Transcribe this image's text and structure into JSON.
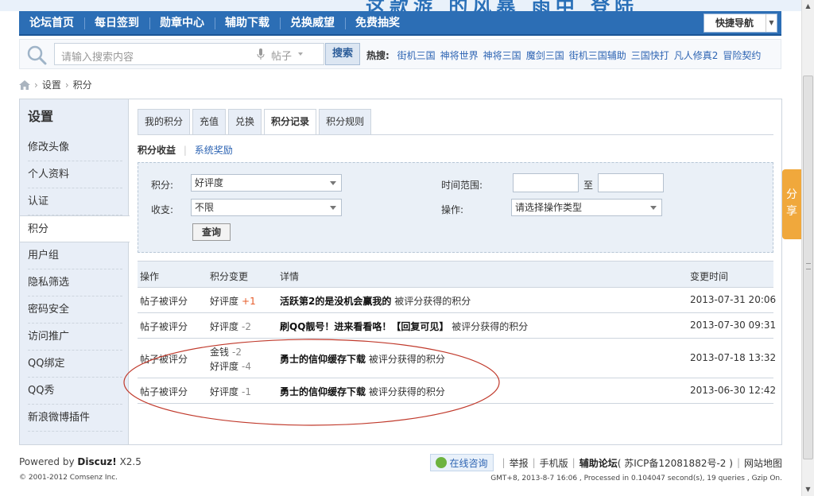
{
  "nav": {
    "items": [
      "论坛首页",
      "每日签到",
      "勋章中心",
      "辅助下载",
      "兑换威望",
      "免费抽奖"
    ],
    "quick_nav": "快捷导航"
  },
  "search": {
    "placeholder": "请输入搜索内容",
    "category": "帖子",
    "button": "搜索",
    "hot_label": "热搜:",
    "hot_terms": [
      "街机三国",
      "神将世界",
      "神将三国",
      "魔剑三国",
      "街机三国辅助",
      "三国快打",
      "凡人修真2",
      "冒险契约"
    ]
  },
  "breadcrumb": [
    "设置",
    "积分"
  ],
  "sidebar": {
    "title": "设置",
    "items": [
      "修改头像",
      "个人资料",
      "认证",
      "积分",
      "用户组",
      "隐私筛选",
      "密码安全",
      "访问推广",
      "QQ绑定",
      "QQ秀",
      "新浪微博插件"
    ]
  },
  "tabs": [
    "我的积分",
    "充值",
    "兑换",
    "积分记录",
    "积分规则"
  ],
  "subtabs": {
    "active": "积分收益",
    "other": "系统奖励"
  },
  "filter": {
    "credit_label": "积分:",
    "credit_value": "好评度",
    "io_label": "收支:",
    "io_value": "不限",
    "time_label": "时间范围:",
    "to": "至",
    "op_label": "操作:",
    "op_value": "请选择操作类型",
    "query": "查询"
  },
  "table": {
    "headers": [
      "操作",
      "积分变更",
      "详情",
      "变更时间"
    ],
    "rows": [
      {
        "op": "帖子被评分",
        "changes": [
          {
            "name": "好评度",
            "amount": "+1"
          }
        ],
        "title": "活跃第2的是没机会赢我的",
        "desc": "被评分获得的积分",
        "time": "2013-07-31 20:06"
      },
      {
        "op": "帖子被评分",
        "changes": [
          {
            "name": "好评度",
            "amount": "-2"
          }
        ],
        "title": "刷QQ靓号！进来看看咯！【回复可见】",
        "desc": "被评分获得的积分",
        "time": "2013-07-30 09:31"
      },
      {
        "op": "帖子被评分",
        "changes": [
          {
            "name": "金钱",
            "amount": "-2"
          },
          {
            "name": "好评度",
            "amount": "-4"
          }
        ],
        "title": "勇士的信仰缓存下载",
        "desc": "被评分获得的积分",
        "time": "2013-07-18 13:32"
      },
      {
        "op": "帖子被评分",
        "changes": [
          {
            "name": "好评度",
            "amount": "-1"
          }
        ],
        "title": "勇士的信仰缓存下载",
        "desc": "被评分获得的积分",
        "time": "2013-06-30 12:42"
      }
    ]
  },
  "share": "分享",
  "footer": {
    "powered_prefix": "Powered by",
    "powered_brand": "Discuz!",
    "powered_version": "X2.5",
    "copyright": "© 2001-2012 Comsenz Inc.",
    "consult": "在线咨询",
    "links": [
      "举报",
      "手机版"
    ],
    "site": "辅助论坛",
    "icp": "( 苏ICP备12081882号-2 )",
    "sitemap": "网站地图",
    "stats": "GMT+8, 2013-8-7 16:06 , Processed in 0.104047 second(s), 19 queries , Gzip On."
  },
  "colors": {
    "nav_bg": "#2c6eb5",
    "link": "#2d64b3",
    "share_bg": "#f0a83c",
    "annotation": "#c0392b"
  }
}
